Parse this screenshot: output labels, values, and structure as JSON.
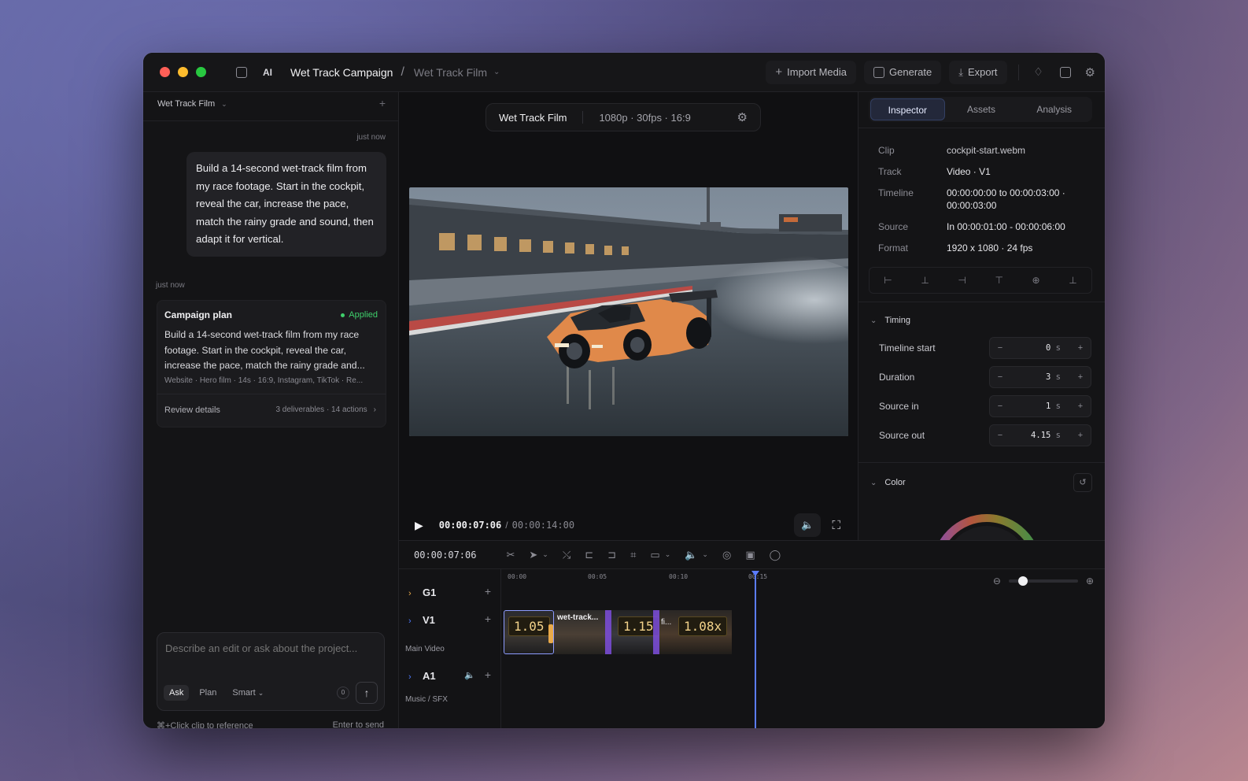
{
  "titlebar": {
    "ai_label": "AI",
    "project": "Wet Track Campaign",
    "separator": "/",
    "sequence": "Wet Track Film",
    "import_label": "Import Media",
    "generate_label": "Generate",
    "export_label": "Export"
  },
  "chat": {
    "header": "Wet Track Film",
    "user_time": "just now",
    "user_message": "Build a 14-second wet-track film from my race footage. Start in the cockpit, reveal the car, increase the pace, match the rainy grade and sound, then adapt it for vertical.",
    "reply_time": "just now",
    "plan": {
      "title": "Campaign plan",
      "status": "Applied",
      "body": "Build a 14-second wet-track film from my race footage. Start in the cockpit, reveal the car, increase the pace, match the rainy grade and...",
      "meta": "Website · Hero film · 14s · 16:9, Instagram, TikTok · Re...",
      "review": "Review details",
      "counts": "3 deliverables · 14 actions"
    },
    "composer": {
      "placeholder": "Describe an edit or ask about the project...",
      "mode_ask": "Ask",
      "mode_plan": "Plan",
      "mode_smart": "Smart",
      "count": "0"
    },
    "hint_left": "⌘+Click clip to reference",
    "hint_right": "Enter to send"
  },
  "viewer": {
    "title": "Wet Track Film",
    "spec": "1080p · 30fps · 16:9",
    "progress": 0.536,
    "current_time": "00:00:07:06",
    "divider": "/",
    "total_time": "00:00:14:00"
  },
  "inspector": {
    "tabs": [
      "Inspector",
      "Assets",
      "Analysis"
    ],
    "active_tab": 0,
    "clip_label": "Clip",
    "clip_value": "cockpit-start.webm",
    "track_label": "Track",
    "track_value": "Video · V1",
    "timeline_label": "Timeline",
    "timeline_value": "00:00:00:00 to 00:00:03:00 · 00:00:03:00",
    "source_label": "Source",
    "source_value": "In 00:00:01:00 - 00:00:06:00",
    "format_label": "Format",
    "format_value": "1920 x 1080 · 24 fps",
    "timing_header": "Timing",
    "timing": [
      {
        "label": "Timeline start",
        "value": "0",
        "unit": "s"
      },
      {
        "label": "Duration",
        "value": "3",
        "unit": "s"
      },
      {
        "label": "Source in",
        "value": "1",
        "unit": "s"
      },
      {
        "label": "Source out",
        "value": "4.15",
        "unit": "s"
      }
    ],
    "color_header": "Color"
  },
  "timeline": {
    "timecode": "00:00:07:06",
    "ruler": [
      "00:00",
      "00:05",
      "00:10",
      "00:15"
    ],
    "zoom_level": 0.2,
    "tracks": {
      "g1": "G1",
      "v1": "V1",
      "v1_sub": "Main Video",
      "a1": "A1",
      "a1_sub": "Music / SFX"
    },
    "clips": {
      "speed1": "1.05",
      "speed2": "1.15",
      "speed3": "1.08x",
      "name2": "wet-track...",
      "name3": "fi..."
    }
  },
  "colors": {
    "accent": "#4f7cff",
    "applied": "#3fcf6b",
    "playhead": "#5b7cff",
    "clip_marker": "#8b5cf6"
  }
}
